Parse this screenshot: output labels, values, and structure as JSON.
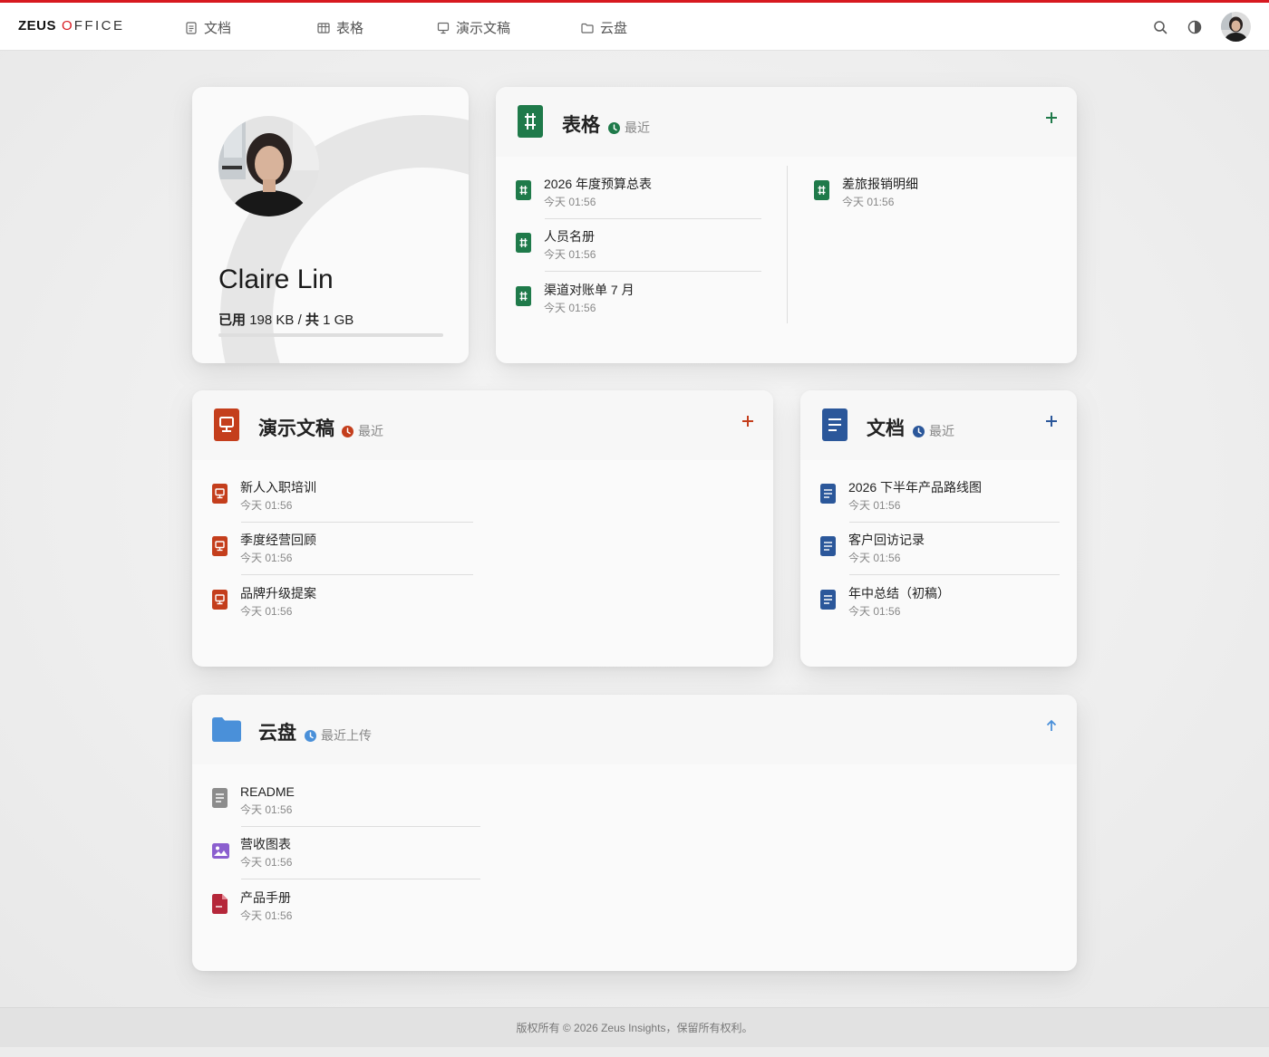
{
  "brand": {
    "bold": "ZEUS",
    "o": "O",
    "rest": "FFICE"
  },
  "nav": [
    {
      "label": "文档",
      "icon": "doc-icon"
    },
    {
      "label": "表格",
      "icon": "table-icon"
    },
    {
      "label": "演示文稿",
      "icon": "presentation-icon"
    },
    {
      "label": "云盘",
      "icon": "folder-icon"
    }
  ],
  "colors": {
    "accent": "#d71920",
    "sheet": "#1f7a4a",
    "slide": "#c43e1c",
    "doc": "#2b579a",
    "cloud": "#4a90d9"
  },
  "profile": {
    "name": "Claire Lin",
    "quota_used_label": "已用",
    "quota_used": "198 KB",
    "quota_sep": "/",
    "quota_total_label": "共",
    "quota_total": "1 GB",
    "quota_fraction": 0.0002
  },
  "sheets": {
    "title": "表格",
    "recent": "最近",
    "items": [
      {
        "name": "2026 年度预算总表",
        "time": "今天 01:56"
      },
      {
        "name": "人员名册",
        "time": "今天 01:56"
      },
      {
        "name": "渠道对账单 7 月",
        "time": "今天 01:56"
      },
      {
        "name": "差旅报销明细",
        "time": "今天 01:56"
      }
    ]
  },
  "slides": {
    "title": "演示文稿",
    "recent": "最近",
    "items": [
      {
        "name": "新人入职培训",
        "time": "今天 01:56"
      },
      {
        "name": "季度经营回顾",
        "time": "今天 01:56"
      },
      {
        "name": "品牌升级提案",
        "time": "今天 01:56"
      }
    ]
  },
  "docs": {
    "title": "文档",
    "recent": "最近",
    "items": [
      {
        "name": "2026 下半年产品路线图",
        "time": "今天 01:56"
      },
      {
        "name": "客户回访记录",
        "time": "今天 01:56"
      },
      {
        "name": "年中总结（初稿）",
        "time": "今天 01:56"
      }
    ]
  },
  "cloud": {
    "title": "云盘",
    "recent": "最近上传",
    "items": [
      {
        "name": "README",
        "time": "今天 01:56",
        "icon": "text-file-icon"
      },
      {
        "name": "营收图表",
        "time": "今天 01:56",
        "icon": "image-file-icon"
      },
      {
        "name": "产品手册",
        "time": "今天 01:56",
        "icon": "pdf-file-icon"
      }
    ]
  },
  "footer": {
    "text": "版权所有 © 2026 Zeus Insights，保留所有权利。"
  }
}
